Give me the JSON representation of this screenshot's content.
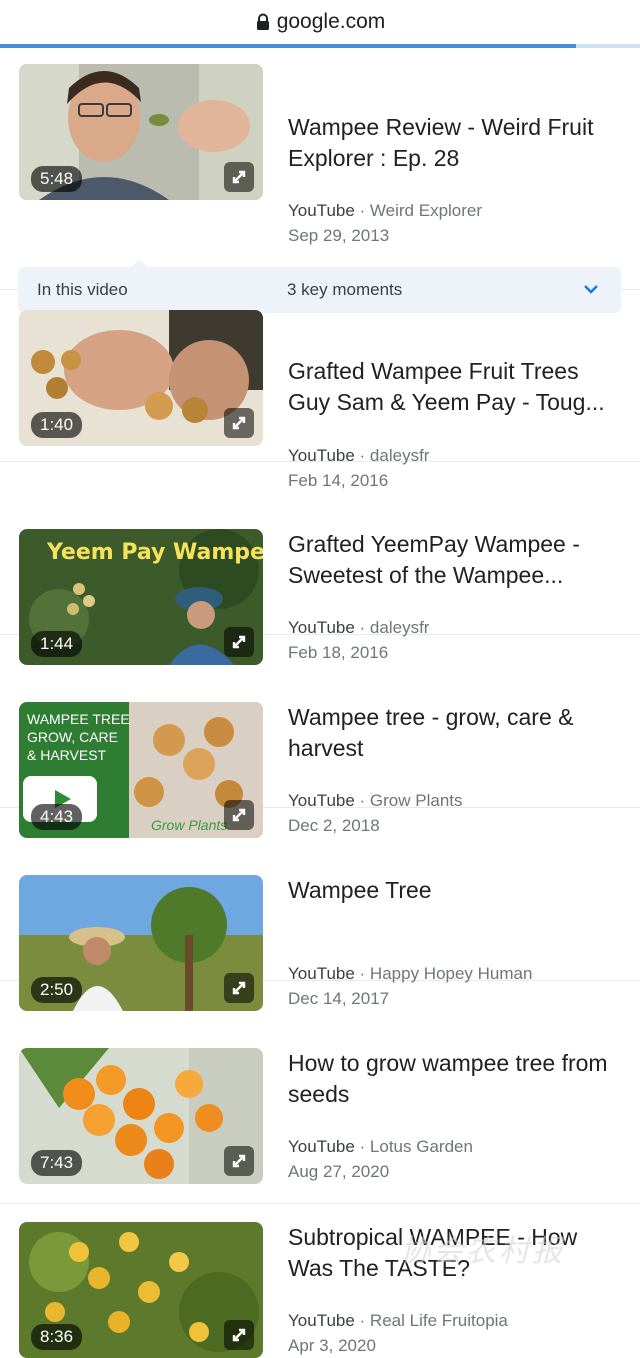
{
  "browser": {
    "domain": "google.com",
    "load_progress": 0.9,
    "icons": [
      "lock-icon"
    ]
  },
  "key_moments": {
    "label": "In this video",
    "count_label": "3 key moments",
    "icon": "chevron-down-icon"
  },
  "results": [
    {
      "title": "Wampee Review - Weird Fruit Explorer : Ep. 28",
      "source": "YouTube",
      "channel": "Weird Explorer",
      "date": "Sep 29, 2013",
      "duration": "5:48"
    },
    {
      "title": "Grafted Wampee Fruit Trees Guy Sam & Yeem Pay - Toug...",
      "source": "YouTube",
      "channel": "daleysfr",
      "date": "Feb 14, 2016",
      "duration": "1:40"
    },
    {
      "title": "Grafted YeemPay Wampee - Sweetest of the Wampee...",
      "source": "YouTube",
      "channel": "daleysfr",
      "date": "Feb 18, 2016",
      "duration": "1:44",
      "thumb_text": "Yeem Pay Wampee"
    },
    {
      "title": "Wampee tree - grow, care & harvest",
      "source": "YouTube",
      "channel": "Grow Plants",
      "date": "Dec 2, 2018",
      "duration": "4:43",
      "thumb_text": "WAMPEE TREE\nGROW, CARE\n& HARVEST",
      "thumb_brand": "Grow Plants"
    },
    {
      "title": "Wampee Tree",
      "source": "YouTube",
      "channel": "Happy Hopey Human",
      "date": "Dec 14, 2017",
      "duration": "2:50"
    },
    {
      "title": "How to grow wampee tree from seeds",
      "source": "YouTube",
      "channel": "Lotus Garden",
      "date": "Aug 27, 2020",
      "duration": "7:43"
    },
    {
      "title": "Subtropical WAMPEE - How Was The TASTE?",
      "source": "YouTube",
      "channel": "Real Life Fruitopia",
      "date": "Apr 3, 2020",
      "duration": "8:36"
    }
  ],
  "watermark": "协会农村报"
}
